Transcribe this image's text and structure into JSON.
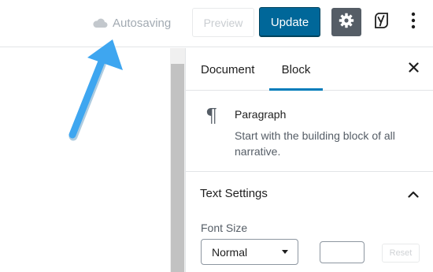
{
  "toolbar": {
    "autosave_label": "Autosaving",
    "preview_label": "Preview",
    "update_label": "Update",
    "settings_icon": "gear-icon",
    "yoast_icon": "yoast-icon",
    "more_icon": "more-vertical-icon"
  },
  "sidebar": {
    "tabs": [
      {
        "label": "Document",
        "active": false
      },
      {
        "label": "Block",
        "active": true
      }
    ],
    "close_icon": "close-icon",
    "block": {
      "icon": "paragraph-icon",
      "icon_glyph": "¶",
      "title": "Paragraph",
      "description": "Start with the building block of all narrative."
    },
    "text_settings": {
      "title": "Text Settings",
      "expanded": true,
      "font_size_label": "Font Size",
      "font_size_value": "Normal",
      "custom_value": "",
      "reset_label": "Reset"
    }
  },
  "colors": {
    "update_button": "#006799",
    "settings_button": "#555d66",
    "active_tab": "#007cba",
    "annotation_arrow": "#3ea6f0"
  }
}
